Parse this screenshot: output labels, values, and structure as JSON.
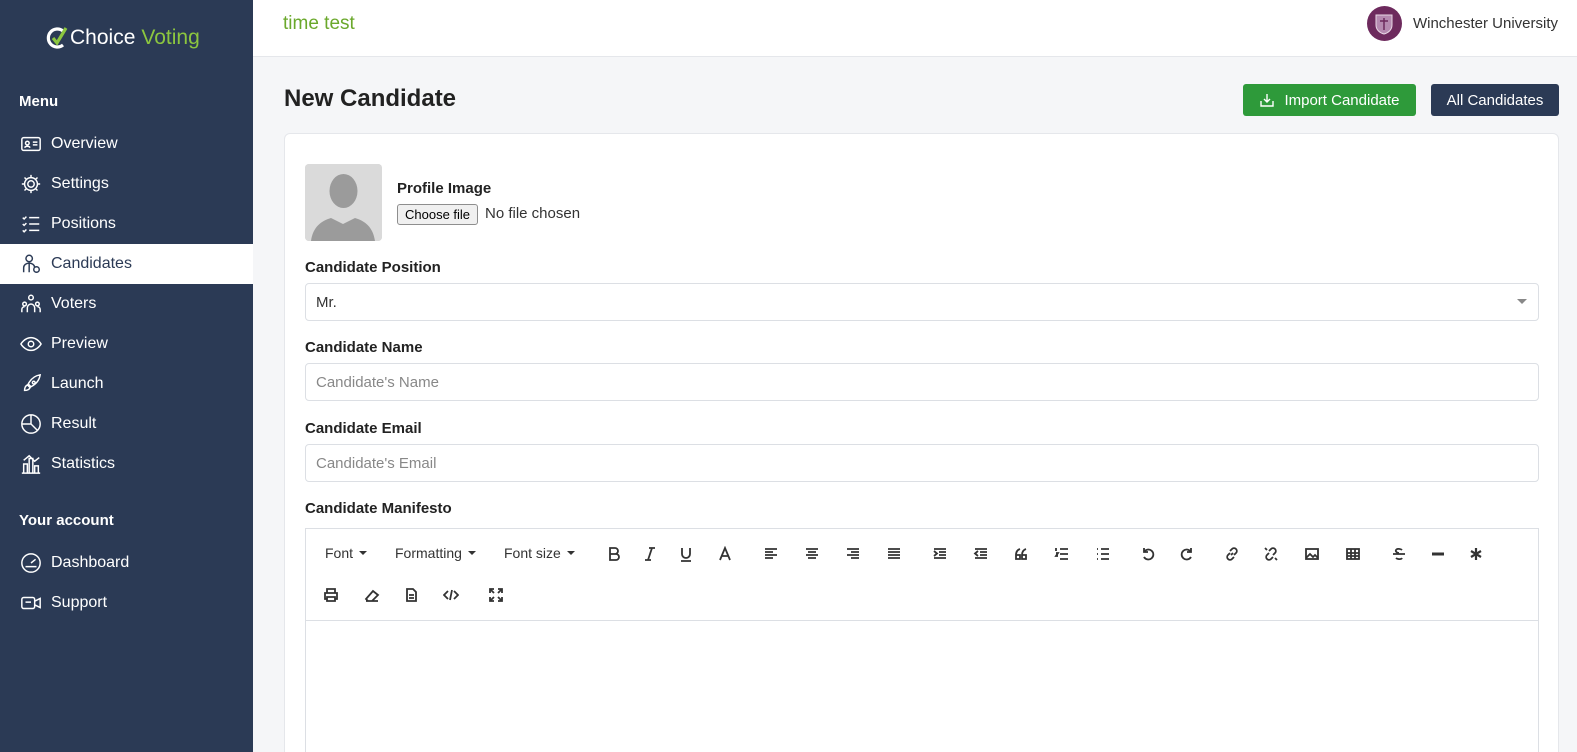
{
  "app": {
    "logo_word1": "Choice",
    "logo_word2": "Voting",
    "brand_green": "#8cc63f",
    "sidebar_color": "#2b3a55"
  },
  "sidebar": {
    "menu_heading": "Menu",
    "items": [
      {
        "label": "Overview",
        "icon": "id-card-icon"
      },
      {
        "label": "Settings",
        "icon": "gear-icon"
      },
      {
        "label": "Positions",
        "icon": "list-icon"
      },
      {
        "label": "Candidates",
        "icon": "candidate-icon",
        "active": true
      },
      {
        "label": "Voters",
        "icon": "voters-icon"
      },
      {
        "label": "Preview",
        "icon": "eye-icon"
      },
      {
        "label": "Launch",
        "icon": "rocket-icon"
      },
      {
        "label": "Result",
        "icon": "pie-chart-icon"
      },
      {
        "label": "Statistics",
        "icon": "bar-chart-icon"
      }
    ],
    "account_heading": "Your account",
    "account_items": [
      {
        "label": "Dashboard",
        "icon": "speedometer-icon"
      },
      {
        "label": "Support",
        "icon": "support-icon"
      }
    ]
  },
  "topbar": {
    "election_title": "time test",
    "organization": "Winchester University"
  },
  "page": {
    "title": "New Candidate",
    "import_button": "Import Candidate",
    "all_button": "All Candidates"
  },
  "form": {
    "profile_label": "Profile Image",
    "file_button": "Choose file",
    "file_status": "No file chosen",
    "position_label": "Candidate Position",
    "position_value": "Mr.",
    "name_label": "Candidate Name",
    "name_placeholder": "Candidate's Name",
    "email_label": "Candidate Email",
    "email_placeholder": "Candidate's Email",
    "manifesto_label": "Candidate Manifesto"
  },
  "editor": {
    "font_label": "Font",
    "formatting_label": "Formatting",
    "fontsize_label": "Font size"
  }
}
